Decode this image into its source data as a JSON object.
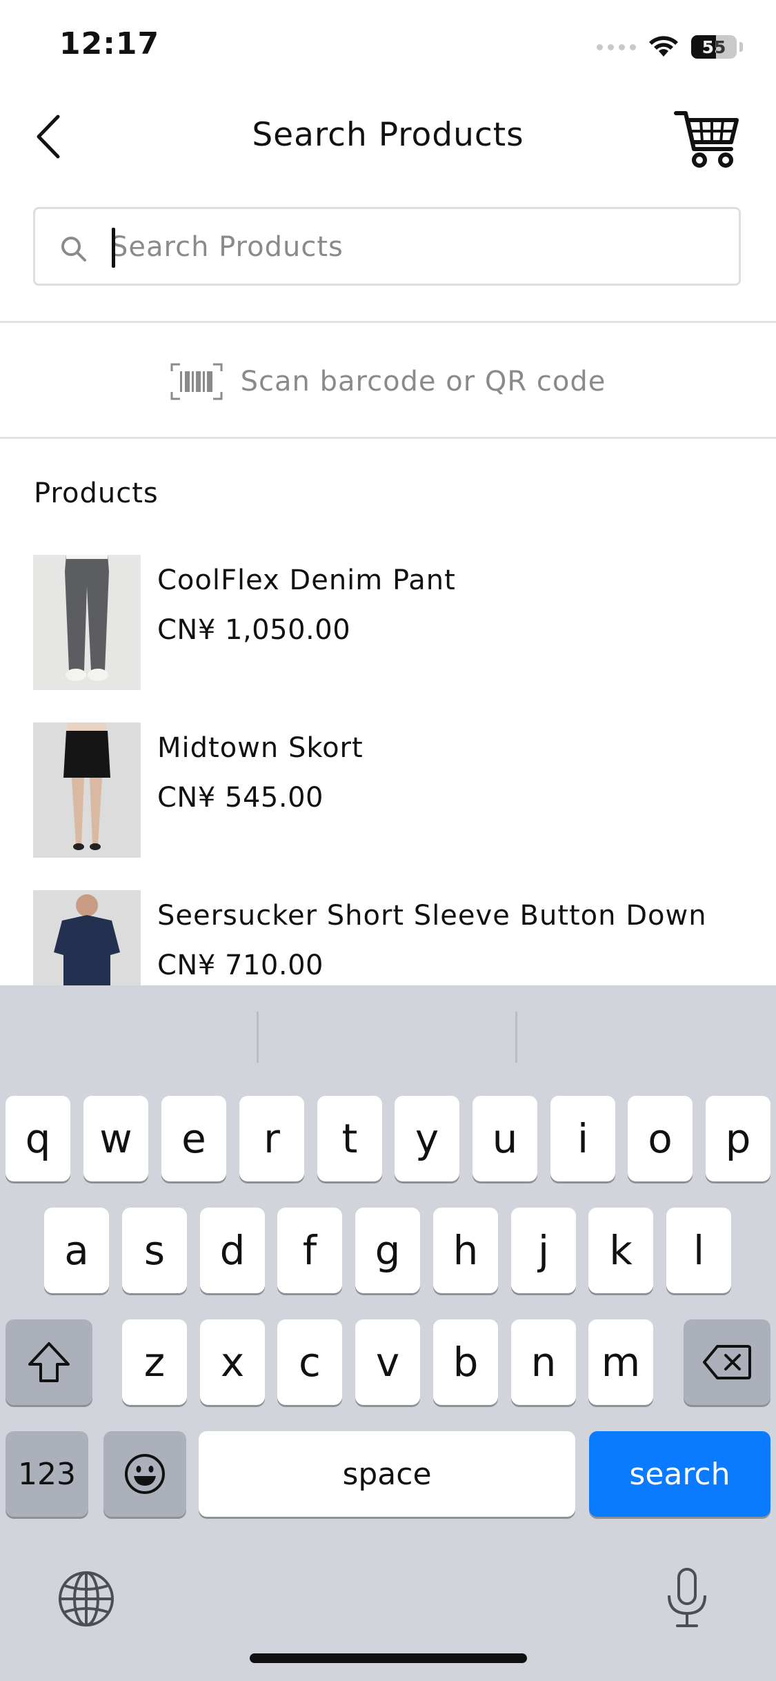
{
  "status_bar": {
    "time": "12:17",
    "battery": "55",
    "battery_level": 0.55
  },
  "nav": {
    "title": "Search Products",
    "back_icon": "chevron-left-icon",
    "cart_icon": "cart-icon"
  },
  "search": {
    "placeholder": "Search Products",
    "value": ""
  },
  "scan": {
    "label": "Scan barcode or QR code",
    "icon": "barcode-scan-icon"
  },
  "products": {
    "heading": "Products",
    "items": [
      {
        "name": "CoolFlex Denim Pant",
        "price": "CN¥ 1,050.00",
        "image": "grey-pants-photo"
      },
      {
        "name": "Midtown Skort",
        "price": "CN¥ 545.00",
        "image": "black-skort-photo"
      },
      {
        "name": "Seersucker Short Sleeve Button Down",
        "price": "CN¥ 710.00",
        "image": "navy-shirt-photo"
      }
    ]
  },
  "keyboard": {
    "row1": [
      "q",
      "w",
      "e",
      "r",
      "t",
      "y",
      "u",
      "i",
      "o",
      "p"
    ],
    "row2": [
      "a",
      "s",
      "d",
      "f",
      "g",
      "h",
      "j",
      "k",
      "l"
    ],
    "row3": [
      "z",
      "x",
      "c",
      "v",
      "b",
      "n",
      "m"
    ],
    "numbers_label": "123",
    "space_label": "space",
    "action_label": "search",
    "action_color": "#0a7aff"
  }
}
